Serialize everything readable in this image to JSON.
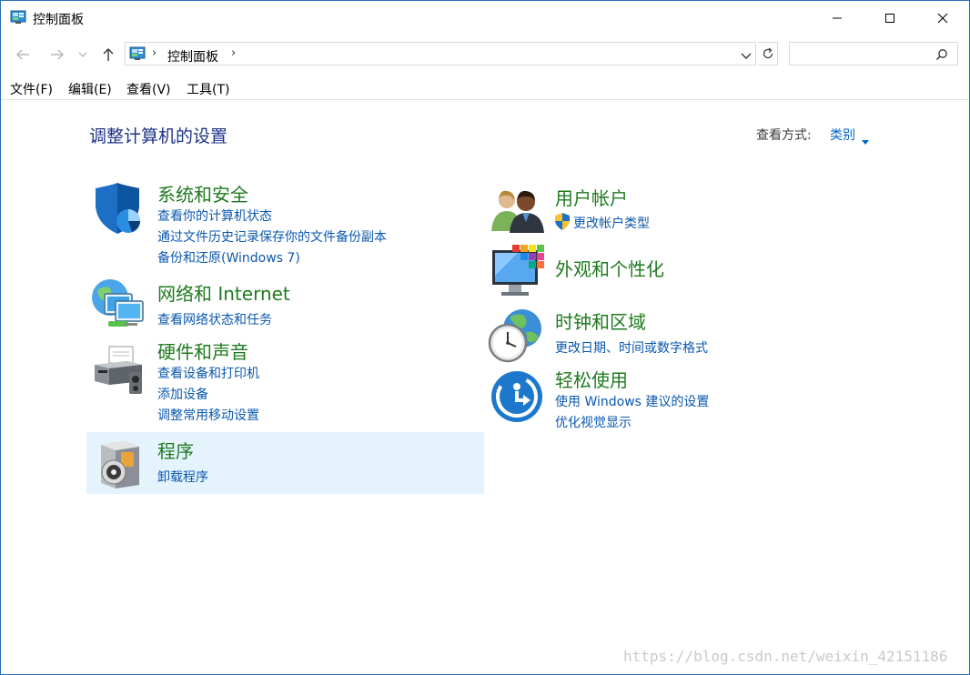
{
  "window": {
    "title": "控制面板"
  },
  "address": {
    "path": "控制面板",
    "separator": "›"
  },
  "search": {
    "placeholder": ""
  },
  "menu": [
    {
      "label": "文件(F)"
    },
    {
      "label": "编辑(E)"
    },
    {
      "label": "查看(V)"
    },
    {
      "label": "工具(T)"
    }
  ],
  "content": {
    "title": "调整计算机的设置",
    "view_by_label": "查看方式:",
    "view_by_value": "类别"
  },
  "categories": {
    "system_security": {
      "title": "系统和安全",
      "icon": "shield-icon",
      "links": [
        "查看你的计算机状态",
        "通过文件历史记录保存你的文件备份副本",
        "备份和还原(Windows 7)"
      ]
    },
    "network": {
      "title": "网络和 Internet",
      "icon": "network-globe-icon",
      "links": [
        "查看网络状态和任务"
      ]
    },
    "hardware": {
      "title": "硬件和声音",
      "icon": "printer-icon",
      "links": [
        "查看设备和打印机",
        "添加设备",
        "调整常用移动设置"
      ]
    },
    "programs": {
      "title": "程序",
      "icon": "programs-disc-icon",
      "links": [
        "卸载程序"
      ]
    },
    "user_accounts": {
      "title": "用户帐户",
      "icon": "users-icon",
      "links": [
        "更改帐户类型"
      ]
    },
    "appearance": {
      "title": "外观和个性化",
      "icon": "monitor-palette-icon",
      "links": []
    },
    "clock_region": {
      "title": "时钟和区域",
      "icon": "clock-globe-icon",
      "links": [
        "更改日期、时间或数字格式"
      ]
    },
    "ease_access": {
      "title": "轻松使用",
      "icon": "ease-of-access-icon",
      "links": [
        "使用 Windows 建议的设置",
        "优化视觉显示"
      ]
    }
  },
  "watermark": "https://blog.csdn.net/weixin_42151186",
  "colors": {
    "category_title": "#1f7a1f",
    "link": "#0a58b0",
    "page_title": "#1e3287",
    "highlight": "#e5f3fd"
  }
}
